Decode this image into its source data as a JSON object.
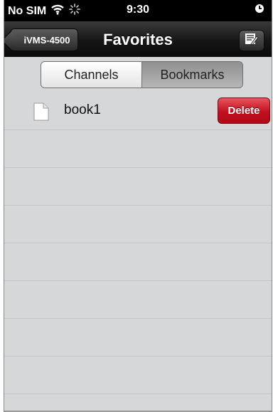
{
  "status_bar": {
    "carrier": "No SIM",
    "time": "9:30"
  },
  "nav": {
    "back_label": "iVMS-4500",
    "title": "Favorites"
  },
  "segments": {
    "channels": "Channels",
    "bookmarks": "Bookmarks",
    "selected": "Bookmarks"
  },
  "list": {
    "items": [
      {
        "label": "book1",
        "delete_label": "Delete"
      }
    ]
  },
  "colors": {
    "delete": "#c3101f",
    "nav": "#161616",
    "list_bg": "#d6d7d9"
  },
  "icons": {
    "wifi": "wifi-icon",
    "activity": "activity-spinner-icon",
    "battery": "status-indicator-icon",
    "edit": "edit-list-icon",
    "file": "document-icon"
  }
}
